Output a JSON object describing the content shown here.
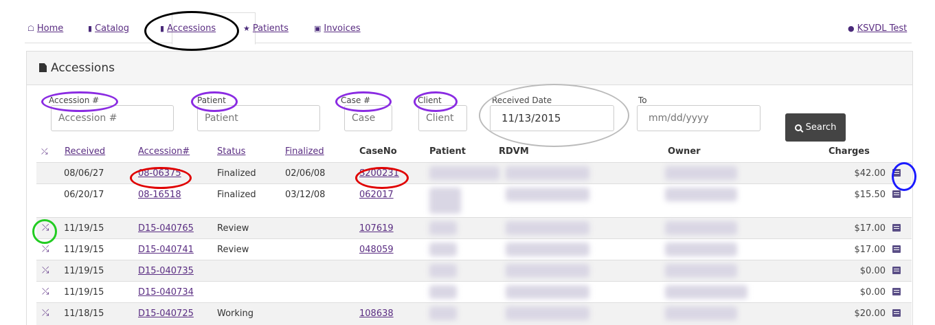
{
  "nav": {
    "home": "Home",
    "catalog": "Catalog",
    "accessions": "Accessions",
    "patients": "Patients",
    "invoices": "Invoices",
    "user": "KSVDL Test"
  },
  "panel": {
    "title": "Accessions"
  },
  "filters": {
    "accession_label": "Accession #",
    "accession_placeholder": "Accession #",
    "patient_label": "Patient",
    "patient_placeholder": "Patient",
    "case_label": "Case #",
    "case_placeholder": "Case",
    "client_label": "Client",
    "client_placeholder": "Client",
    "received_label": "Received Date",
    "received_value": "11/13/2015",
    "to_label": "To",
    "to_placeholder": "mm/dd/yyyy",
    "search_label": "Search"
  },
  "table": {
    "headers": {
      "received": "Received",
      "accession": "Accession#",
      "status": "Status",
      "finalized": "Finalized",
      "caseno": "CaseNo",
      "patient": "Patient",
      "rdvm": "RDVM",
      "owner": "Owner",
      "charges": "Charges"
    },
    "rows": [
      {
        "received": "08/06/27",
        "accession": "08-06375",
        "status": "Finalized",
        "finalized": "02/06/08",
        "caseno": "S200231",
        "charges": "$42.00"
      },
      {
        "received": "06/20/17",
        "accession": "08-16518",
        "status": "Finalized",
        "finalized": "03/12/08",
        "caseno": "062017",
        "charges": "$15.50"
      },
      {
        "received": "11/19/15",
        "accession": "D15-040765",
        "status": "Review",
        "finalized": "",
        "caseno": "107619",
        "charges": "$17.00"
      },
      {
        "received": "11/19/15",
        "accession": "D15-040741",
        "status": "Review",
        "finalized": "",
        "caseno": "048059",
        "charges": "$17.00"
      },
      {
        "received": "11/19/15",
        "accession": "D15-040735",
        "status": "",
        "finalized": "",
        "caseno": "",
        "charges": "$0.00"
      },
      {
        "received": "11/19/15",
        "accession": "D15-040734",
        "status": "",
        "finalized": "",
        "caseno": "",
        "charges": "$0.00"
      },
      {
        "received": "11/18/15",
        "accession": "D15-040725",
        "status": "Working",
        "finalized": "",
        "caseno": "108638",
        "charges": "$20.00"
      }
    ]
  },
  "colors": {
    "link": "#5a2d82",
    "ring_black": "#000000",
    "ring_purple": "#8a2be2",
    "ring_red": "#e00000",
    "ring_blue": "#1a1aff",
    "ring_green": "#22cc22"
  }
}
